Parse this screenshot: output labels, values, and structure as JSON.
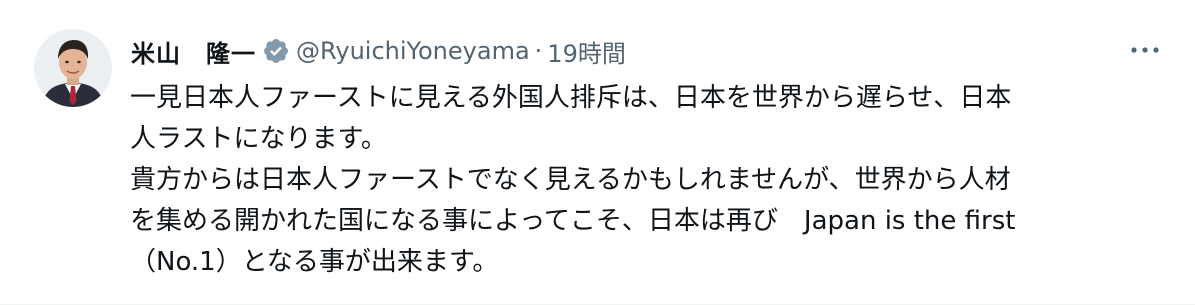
{
  "tweet": {
    "display_name": "米山　隆一",
    "handle": "@RyuichiYoneyama",
    "separator": "·",
    "timestamp": "19時間",
    "verified_icon": "verified-badge-icon",
    "more_icon": "more-options-icon",
    "lines": [
      "一見日本人ファーストに見える外国人排斥は、日本を世界から遅らせ、日本",
      "人ラストになります。",
      "貴方からは日本人ファーストでなく見えるかもしれませんが、世界から人材",
      "を集める開かれた国になる事によってこそ、日本は再び　Japan is the first",
      "（No.1）となる事が出来ます。"
    ]
  },
  "colors": {
    "text_primary": "#0f1419",
    "text_secondary": "#536471",
    "verified_badge": "#829aab"
  }
}
